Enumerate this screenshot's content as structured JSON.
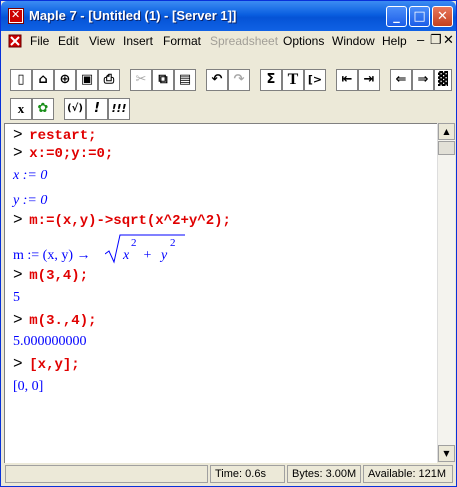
{
  "window": {
    "title": "Maple 7  - [Untitled (1) - [Server 1]]"
  },
  "menu": {
    "file": "File",
    "edit": "Edit",
    "view": "View",
    "insert": "Insert",
    "format": "Format",
    "spreadsheet": "Spreadsheet",
    "options": "Options",
    "window": "Window",
    "help": "Help"
  },
  "toolbar": {
    "sum": "Σ",
    "text": "T",
    "exec": "[>",
    "x_button": "x",
    "paren": "(√)",
    "bang": "!",
    "triple_bang": "!!!"
  },
  "worksheet": {
    "prompt": ">",
    "cmd1": "restart;",
    "cmd2": "x:=0;y:=0;",
    "out2a": "x := 0",
    "out2b": "y := 0",
    "cmd3": "m:=(x,y)->sqrt(x^2+y^2);",
    "out3_lhs": "m := (x, y) → ",
    "out3_x": "x",
    "out3_plus": " + ",
    "out3_y": "y",
    "out3_exp": "2",
    "cmd4": "m(3,4);",
    "out4": "5",
    "cmd5": "m(3.,4);",
    "out5": "5.000000000",
    "cmd6": "[x,y];",
    "out6": "[0, 0]"
  },
  "status": {
    "time": "Time:  0.6s",
    "bytes": "Bytes: 3.00M",
    "available": "Available: 121M"
  },
  "colors": {
    "command": "#e00000",
    "output": "#0000ff",
    "titlebar": "#0a5fe0"
  }
}
